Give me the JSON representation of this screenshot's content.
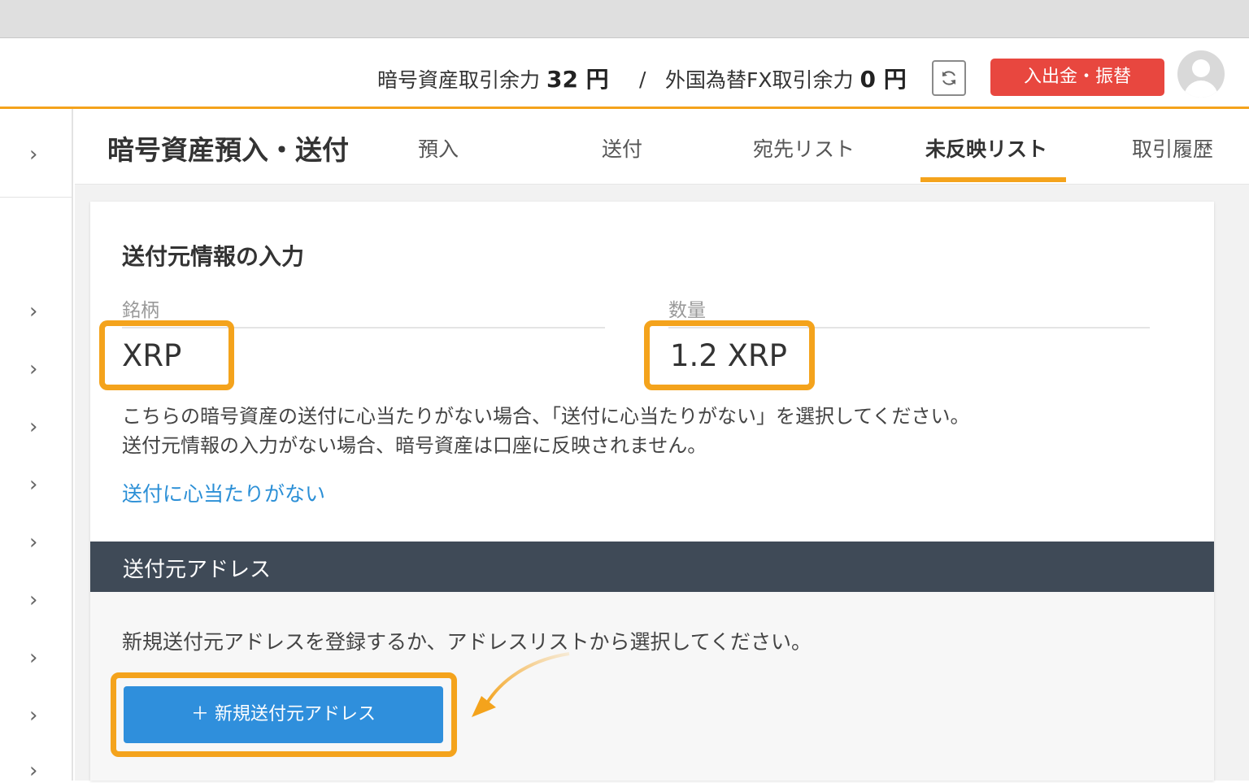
{
  "header": {
    "crypto_balance_label": "暗号資産取引余力",
    "crypto_balance_value": "32 円",
    "separator": "/",
    "fx_balance_label": "外国為替FX取引余力",
    "fx_balance_value": "0 円",
    "deposit_button_label": "入出金・振替",
    "refresh_icon": "refresh-icon",
    "avatar_icon": "user-avatar-icon"
  },
  "sidebar": {
    "chevron_glyph": "›",
    "item_count": 10
  },
  "subnav": {
    "title": "暗号資産預入・送付",
    "tabs": [
      {
        "label": "預入",
        "active": false
      },
      {
        "label": "送付",
        "active": false
      },
      {
        "label": "宛先リスト",
        "active": false
      },
      {
        "label": "未反映リスト",
        "active": true
      },
      {
        "label": "取引履歴",
        "active": false
      }
    ]
  },
  "source_info": {
    "section_title": "送付元情報の入力",
    "symbol_label": "銘柄",
    "symbol_value": "XRP",
    "quantity_label": "数量",
    "quantity_value": "1.2 XRP",
    "notice_line1": "こちらの暗号資産の送付に心当たりがない場合、「送付に心当たりがない」を選択してください。",
    "notice_line2": "送付元情報の入力がない場合、暗号資産は口座に反映されません。",
    "no_idea_link": "送付に心当たりがない"
  },
  "source_address": {
    "section_title": "送付元アドレス",
    "instruction": "新規送付元アドレスを登録するか、アドレスリストから選択してください。",
    "new_address_button": "＋ 新規送付元アドレス"
  },
  "colors": {
    "accent_orange": "#f4a31c",
    "deposit_red": "#e8473f",
    "primary_blue": "#2f8fdc",
    "link_blue": "#2b8fd6",
    "dark_bar": "#3f4a57"
  }
}
